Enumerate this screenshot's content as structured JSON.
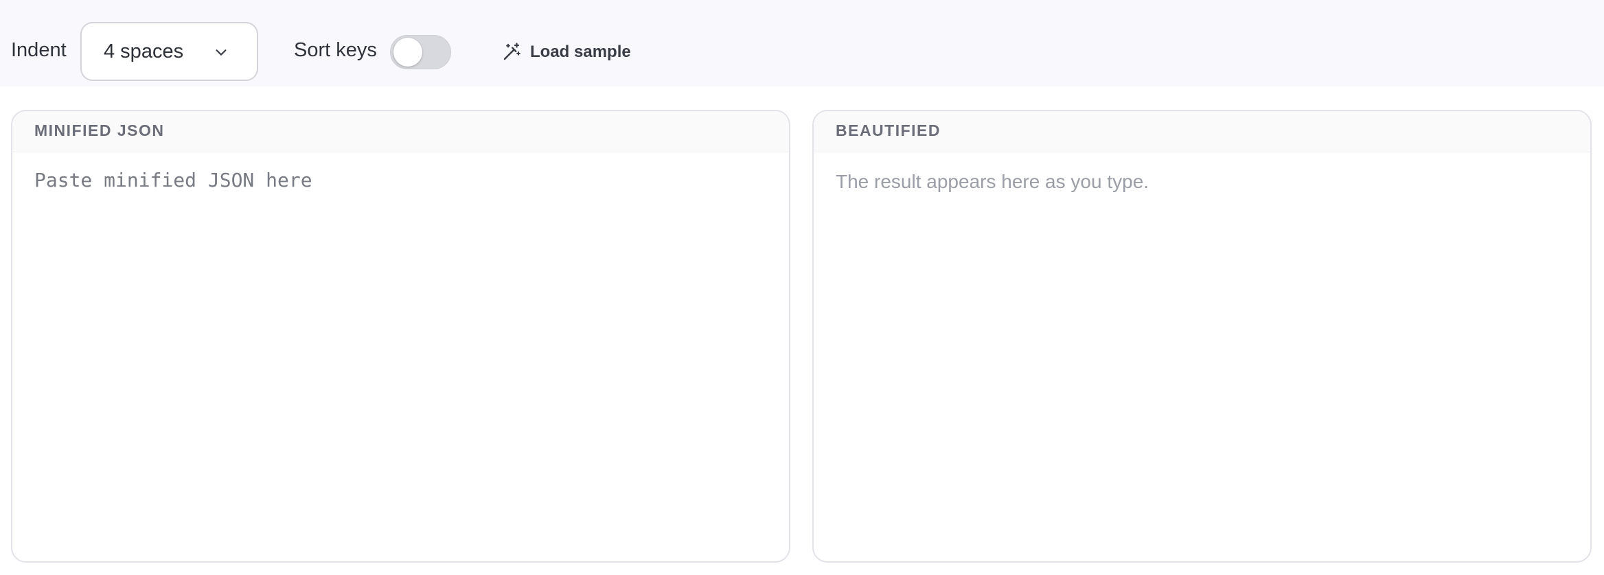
{
  "toolbar": {
    "indent_label": "Indent",
    "indent_value": "4 spaces",
    "sort_keys_label": "Sort keys",
    "sort_keys_on": false,
    "load_sample_label": "Load sample"
  },
  "input_panel": {
    "title": "MINIFIED JSON",
    "value": "",
    "placeholder": "Paste minified JSON here"
  },
  "output_panel": {
    "title": "BEAUTIFIED",
    "placeholder": "The result appears here as you type."
  },
  "icons": {
    "dropdown": "chevron-down-icon",
    "load_sample": "magic-wand-icon"
  },
  "colors": {
    "toolbar_background": "#f8f8fd",
    "panel_border": "#e2e3e8",
    "toggle_off": "#d8d9de",
    "placeholder_text": "#9b9ea6"
  }
}
